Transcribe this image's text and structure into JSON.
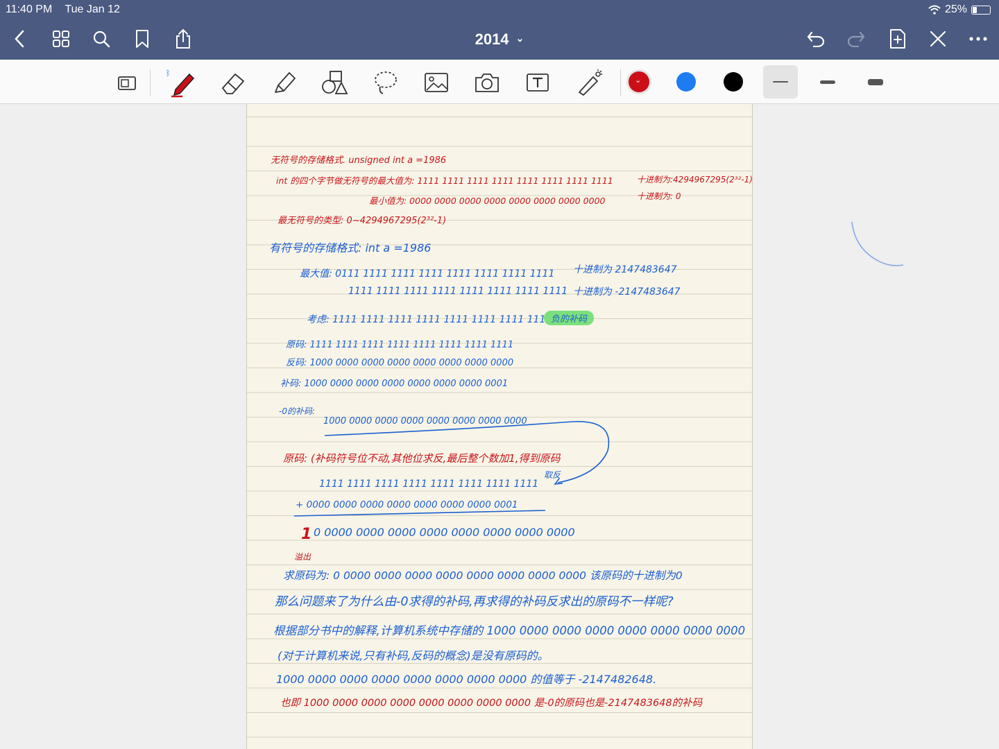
{
  "status_bar": {
    "time": "11:40 PM",
    "date": "Tue Jan 12",
    "battery": "25%",
    "battery_level": 0.25
  },
  "nav": {
    "title": "2014",
    "title_chevron": "⌄"
  },
  "toolbar": {
    "colors": [
      "#cc0f17",
      "#1e7cf2",
      "#000000"
    ],
    "selected_color_index": 0
  },
  "note": {
    "lines": [
      {
        "text": "无符号的存储格式. unsigned int a =1986",
        "color": "red"
      },
      {
        "text": "int 的四个字节做无符号的最大值为: 1111 1111 1111 1111 1111 1111 1111 1111",
        "color": "red"
      },
      {
        "text": "十进制为:4294967295(2³²-1)",
        "color": "red"
      },
      {
        "text": "最小值为: 0000 0000 0000 0000 0000 0000 0000 0000",
        "color": "red"
      },
      {
        "text": "十进制为: 0",
        "color": "red"
      },
      {
        "text": "最无符号的类型: 0~4294967295(2³²-1)",
        "color": "red"
      },
      {
        "text": "有符号的存储格式: int a =1986",
        "color": "blue"
      },
      {
        "text": "最大值: 0111 1111 1111 1111 1111 1111 1111 1111",
        "color": "blue"
      },
      {
        "text": "十进制为 2147483647",
        "color": "blue"
      },
      {
        "text": "1111 1111 1111 1111 1111 1111 1111 1111",
        "color": "blue"
      },
      {
        "text": "十进制为 -2147483647",
        "color": "blue"
      },
      {
        "text": "考虑: 1111 1111 1111 1111 1111 1111 1111 1111",
        "color": "blue"
      },
      {
        "text": "负的补码",
        "color": "highlight"
      },
      {
        "text": "原码: 1111 1111 1111 1111 1111 1111 1111 1111",
        "color": "blue"
      },
      {
        "text": "反码: 1000 0000 0000 0000 0000 0000 0000 0000",
        "color": "blue"
      },
      {
        "text": "补码: 1000 0000 0000 0000 0000 0000 0000 0001",
        "color": "blue"
      },
      {
        "text": "-0的补码:",
        "color": "blue"
      },
      {
        "text": "1000 0000 0000 0000 0000 0000 0000 0000",
        "color": "blue"
      },
      {
        "text": "原码: (补码符号位不动,其他位求反,最后整个数加1,得到原码",
        "color": "red"
      },
      {
        "text": "取反",
        "color": "blue"
      },
      {
        "text": "1111 1111 1111 1111 1111 1111 1111 1111",
        "color": "blue"
      },
      {
        "text": "+  0000 0000 0000 0000 0000 0000 0000 0001",
        "color": "blue"
      },
      {
        "text": "1",
        "color": "red"
      },
      {
        "text": "0 0000 0000 0000 0000 0000 0000 0000 0000",
        "color": "blue"
      },
      {
        "text": "溢出",
        "color": "red"
      },
      {
        "text": "求原码为: 0 0000 0000 0000 0000 0000 0000 0000 0000 该原码的十进制为0",
        "color": "blue"
      },
      {
        "text": "那么问题来了为什么由-0求得的补码,再求得的补码反求出的原码不一样呢?",
        "color": "blue"
      },
      {
        "text": "根据部分书中的解释,计算机系统中存储的 1000 0000 0000 0000 0000 0000 0000 0000",
        "color": "blue"
      },
      {
        "text": "(对于计算机来说,只有补码,反码的概念)是没有原码的。",
        "color": "blue"
      },
      {
        "text": "1000 0000 0000 0000 0000 0000 0000 0000 的值等于 -2147482648.",
        "color": "blue"
      },
      {
        "text": "也即 1000 0000 0000 0000 0000 0000 0000 0000 是-0的原码也是-2147483648的补码",
        "color": "red"
      }
    ]
  }
}
